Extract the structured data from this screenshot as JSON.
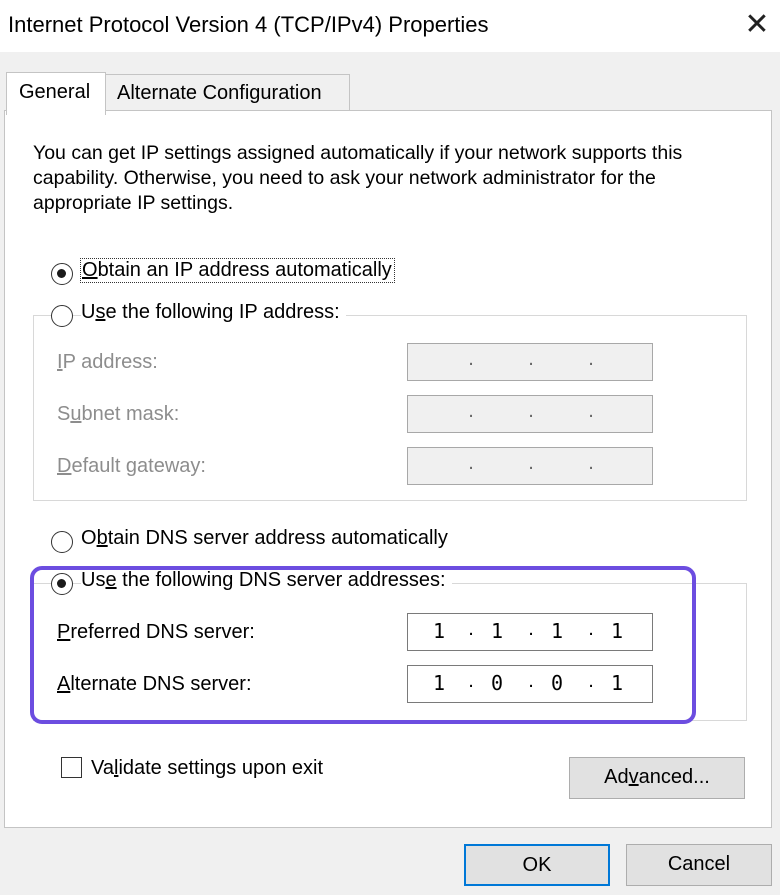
{
  "window": {
    "title": "Internet Protocol Version 4 (TCP/IPv4) Properties",
    "close_glyph": "✕"
  },
  "tabs": [
    {
      "label": "General",
      "selected": true
    },
    {
      "label": "Alternate Configuration",
      "selected": false
    }
  ],
  "info_text": "You can get IP settings assigned automatically if your network supports this capability. Otherwise, you need to ask your network administrator for the appropriate IP settings.",
  "ip": {
    "auto": {
      "pre": "",
      "key": "O",
      "post": "btain an IP address automatically",
      "selected": true
    },
    "manual": {
      "pre": "U",
      "key": "s",
      "post": "e the following IP address:",
      "selected": false
    },
    "fields": [
      {
        "pre": "",
        "key": "I",
        "post": "P address:",
        "octets": [
          "",
          "",
          "",
          ""
        ]
      },
      {
        "pre": "S",
        "key": "u",
        "post": "bnet mask:",
        "octets": [
          "",
          "",
          "",
          ""
        ]
      },
      {
        "pre": "",
        "key": "D",
        "post": "efault gateway:",
        "octets": [
          "",
          "",
          "",
          ""
        ]
      }
    ]
  },
  "dns": {
    "auto": {
      "pre": "O",
      "key": "b",
      "post": "tain DNS server address automatically",
      "selected": false
    },
    "manual": {
      "pre": "Us",
      "key": "e",
      "post": " the following DNS server addresses:",
      "selected": true
    },
    "preferred": {
      "pre": "",
      "key": "P",
      "post": "referred DNS server:",
      "octets": [
        "1",
        "1",
        "1",
        "1"
      ]
    },
    "alternate": {
      "pre": "",
      "key": "A",
      "post": "lternate DNS server:",
      "octets": [
        "1",
        "0",
        "0",
        "1"
      ]
    }
  },
  "highlight_color": "#6c4de0",
  "validate": {
    "pre": "Va",
    "key": "l",
    "post": "idate settings upon exit",
    "checked": false
  },
  "advanced": {
    "pre": "Ad",
    "key": "v",
    "post": "anced..."
  },
  "ok_label": "OK",
  "cancel_label": "Cancel",
  "dot_glyph": "."
}
